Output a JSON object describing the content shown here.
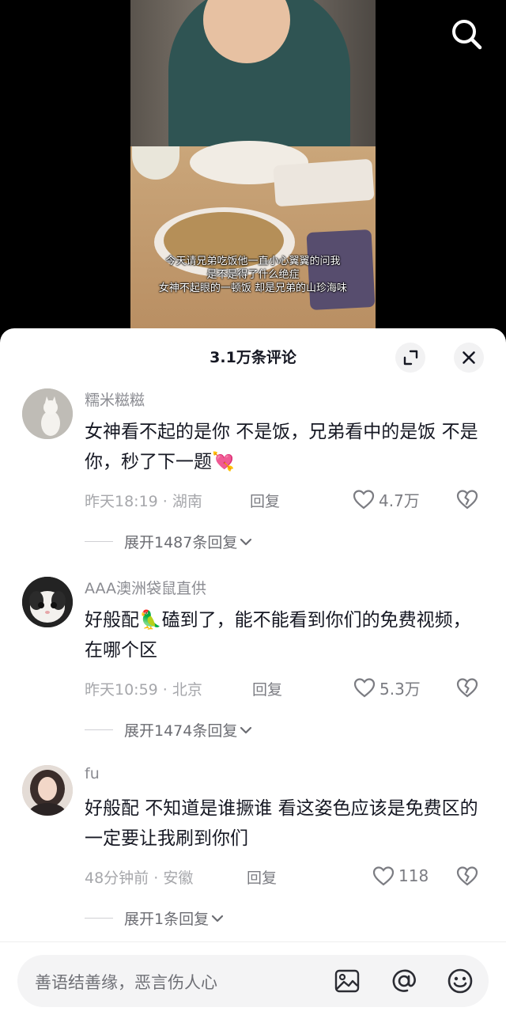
{
  "video": {
    "subtitles": [
      "今天请兄弟吃饭他一直小心翼翼的问我",
      "是不是得了什么绝症",
      "女神不起眼的一顿饭 却是兄弟的山珍海味"
    ],
    "search_icon": "search-icon"
  },
  "sheet": {
    "title": "3.1万条评论",
    "expand_icon": "expand-icon",
    "close_icon": "close-icon"
  },
  "comments": [
    {
      "username": "糯米糍糍",
      "text": "女神看不起的是你 不是饭，兄弟看中的是饭 不是你，秒了下一题💘",
      "time": "昨天18:19",
      "location": "湖南",
      "reply_label": "回复",
      "likes": "4.7万",
      "expand_label": "展开1487条回复"
    },
    {
      "username": "AAA澳洲袋鼠直供",
      "text": "好般配🦜磕到了，能不能看到你们的免费视频，在哪个区",
      "time": "昨天10:59",
      "location": "北京",
      "reply_label": "回复",
      "likes": "5.3万",
      "expand_label": "展开1474条回复"
    },
    {
      "username": "fu",
      "text": "好般配 不知道是谁撅谁 看这姿色应该是免费区的 一定要让我刷到你们",
      "time": "48分钟前",
      "location": "安徽",
      "reply_label": "回复",
      "likes": "118",
      "expand_label": "展开1条回复"
    }
  ],
  "input": {
    "placeholder": "善语结善缘，恶言伤人心",
    "icons": [
      "image-icon",
      "at-icon",
      "emoji-icon"
    ]
  },
  "colors": {
    "sheet_bg": "#ffffff",
    "text_primary": "#161823",
    "text_secondary": "#8a8b91"
  }
}
